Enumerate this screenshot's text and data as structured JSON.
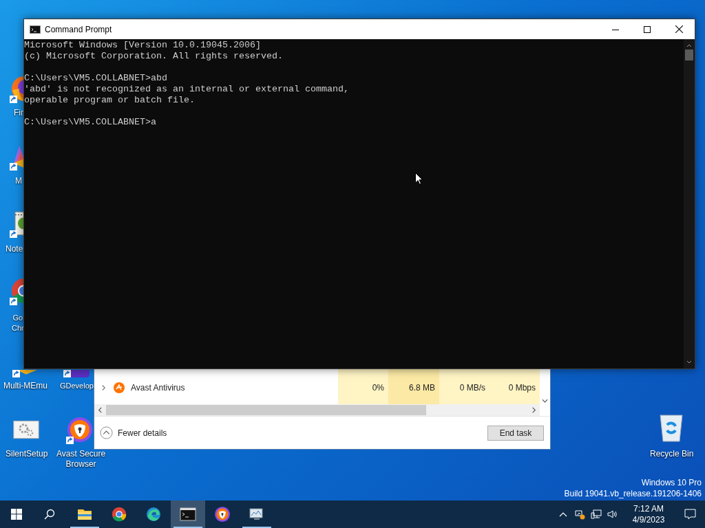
{
  "desktop_icons": [
    {
      "kind": "firefox",
      "lines": [
        "Fir"
      ],
      "shortcut": true
    },
    {
      "kind": "memu",
      "lines": [
        "M"
      ],
      "shortcut": true
    },
    {
      "kind": "notepad",
      "lines": [
        "Note"
      ],
      "shortcut": true
    },
    {
      "kind": "chrome",
      "lines": [
        "Go",
        "Chr"
      ],
      "shortcut": true
    },
    {
      "kind": "memu",
      "lines": [
        "Multi-MEmu"
      ],
      "shortcut": true
    },
    {
      "kind": "gdevelop",
      "lines": [
        "GDevelop"
      ],
      "shortcut": true
    },
    {
      "kind": "setup",
      "lines": [
        "SilentSetup"
      ],
      "shortcut": false
    },
    {
      "kind": "avast",
      "lines": [
        "Avast Secure",
        "Browser"
      ],
      "shortcut": true
    },
    {
      "kind": "recycle",
      "lines": [
        "Recycle Bin"
      ],
      "shortcut": false
    }
  ],
  "task_manager": {
    "rows": [
      {
        "name": "Avast Antivirus",
        "cells": [
          "0%",
          "6.8 MB",
          "0 MB/s",
          "0 Mbps"
        ]
      }
    ],
    "fewer_details": "Fewer details",
    "end_task": "End task"
  },
  "command_prompt": {
    "title": "Command Prompt",
    "blocks": [
      [
        "Microsoft Windows [Version 10.0.19045.2006]",
        "(c) Microsoft Corporation. All rights reserved."
      ],
      [
        "C:\\Users\\VM5.COLLABNET>abd",
        "'abd' is not recognized as an internal or external command,",
        "operable program or batch file."
      ],
      [
        "C:\\Users\\VM5.COLLABNET>a"
      ]
    ]
  },
  "os_info": [
    "Windows 10 Pro",
    "Build 19041.vb_release.191206-1406"
  ],
  "taskbar": {
    "apps": [
      {
        "kind": "explorer",
        "running": true,
        "selected": false
      },
      {
        "kind": "chrome",
        "running": false,
        "selected": false
      },
      {
        "kind": "edge",
        "running": false,
        "selected": false
      },
      {
        "kind": "cmd",
        "running": true,
        "selected": true
      },
      {
        "kind": "avast",
        "running": false,
        "selected": false
      },
      {
        "kind": "monitor",
        "running": true,
        "selected": false
      }
    ],
    "time": "7:12 AM",
    "date": "4/9/2023"
  }
}
